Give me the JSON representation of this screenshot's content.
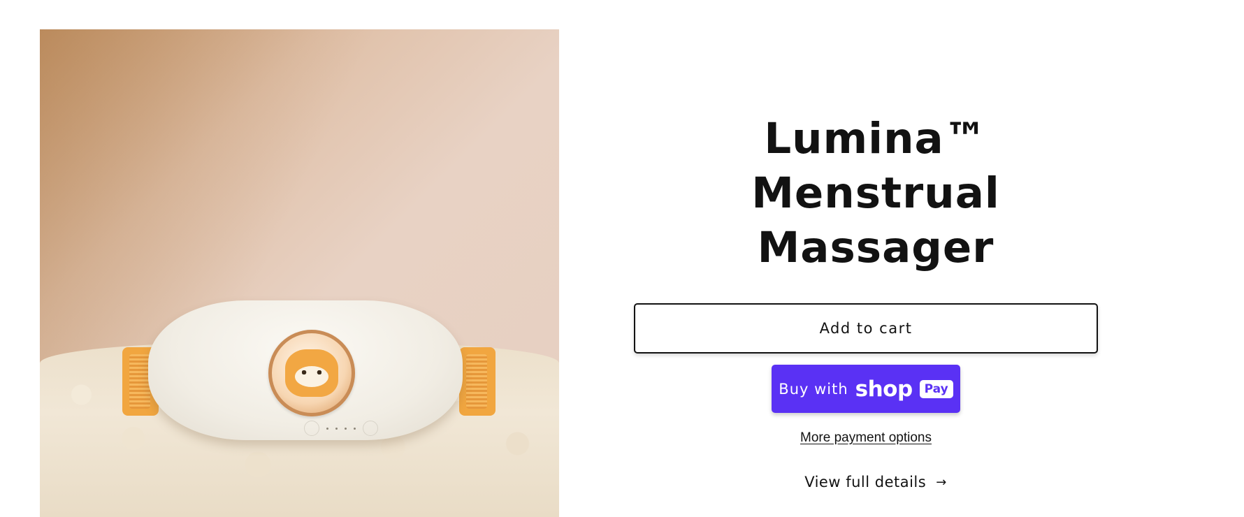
{
  "product": {
    "title": "Lumina™ Menstrual Massager",
    "image_alt": "White heating massager belt with orange straps and a shiba figure in a dome, resting on fluffy cream fabric"
  },
  "actions": {
    "add_to_cart_label": "Add to cart",
    "buy_with_label": "Buy with",
    "shop_logo_text": "shop",
    "pay_pill_text": "Pay",
    "more_payment_label": "More payment options",
    "view_details_label": "View full details",
    "view_details_arrow": "→"
  },
  "colors": {
    "text": "#121212",
    "shop_pay_purple": "#5a31f4",
    "background": "#ffffff"
  }
}
